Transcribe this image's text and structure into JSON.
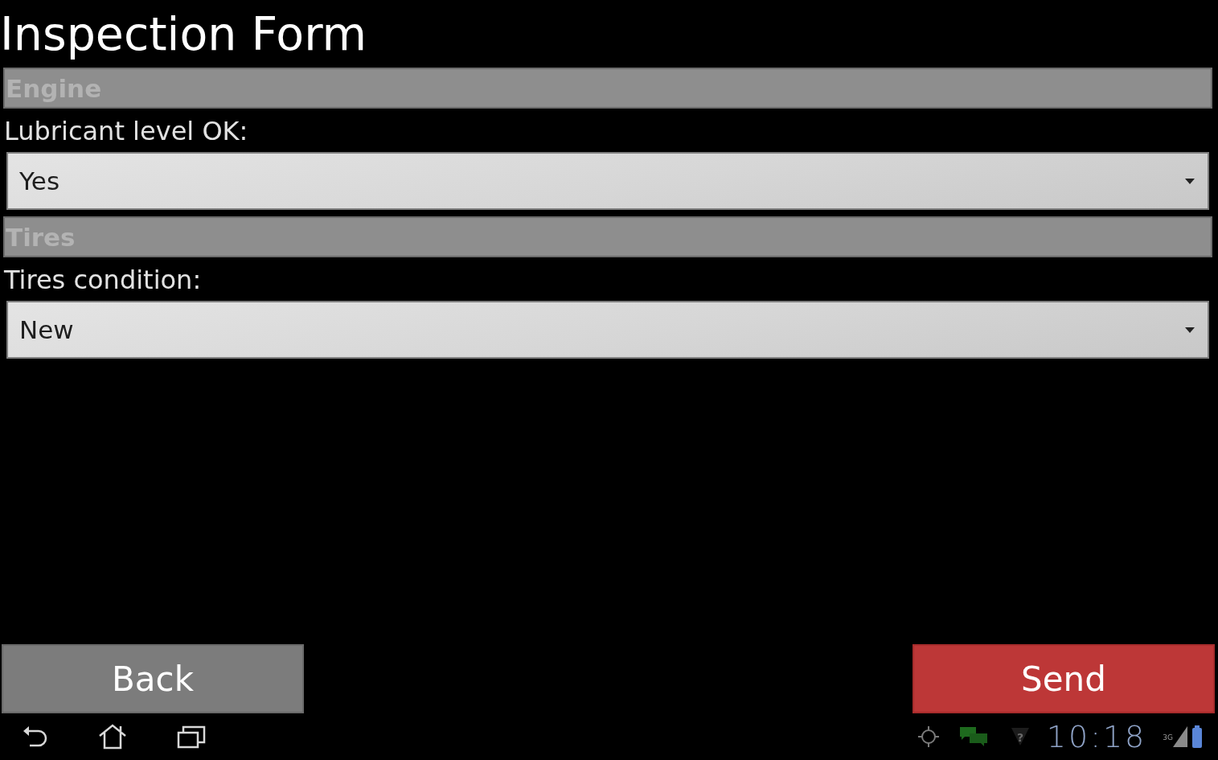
{
  "title": "Inspection Form",
  "sections": [
    {
      "heading": "Engine",
      "fields": [
        {
          "label": "Lubricant level OK:",
          "value": "Yes"
        }
      ]
    },
    {
      "heading": "Tires",
      "fields": [
        {
          "label": "Tires condition:",
          "value": "New"
        }
      ]
    }
  ],
  "buttons": [
    {
      "label": "Back",
      "kind": "secondary"
    },
    {
      "label": "Send",
      "kind": "primary"
    }
  ],
  "status_bar": {
    "unknown_signal_glyph": "?",
    "time": "10:18",
    "network": "3G"
  }
}
